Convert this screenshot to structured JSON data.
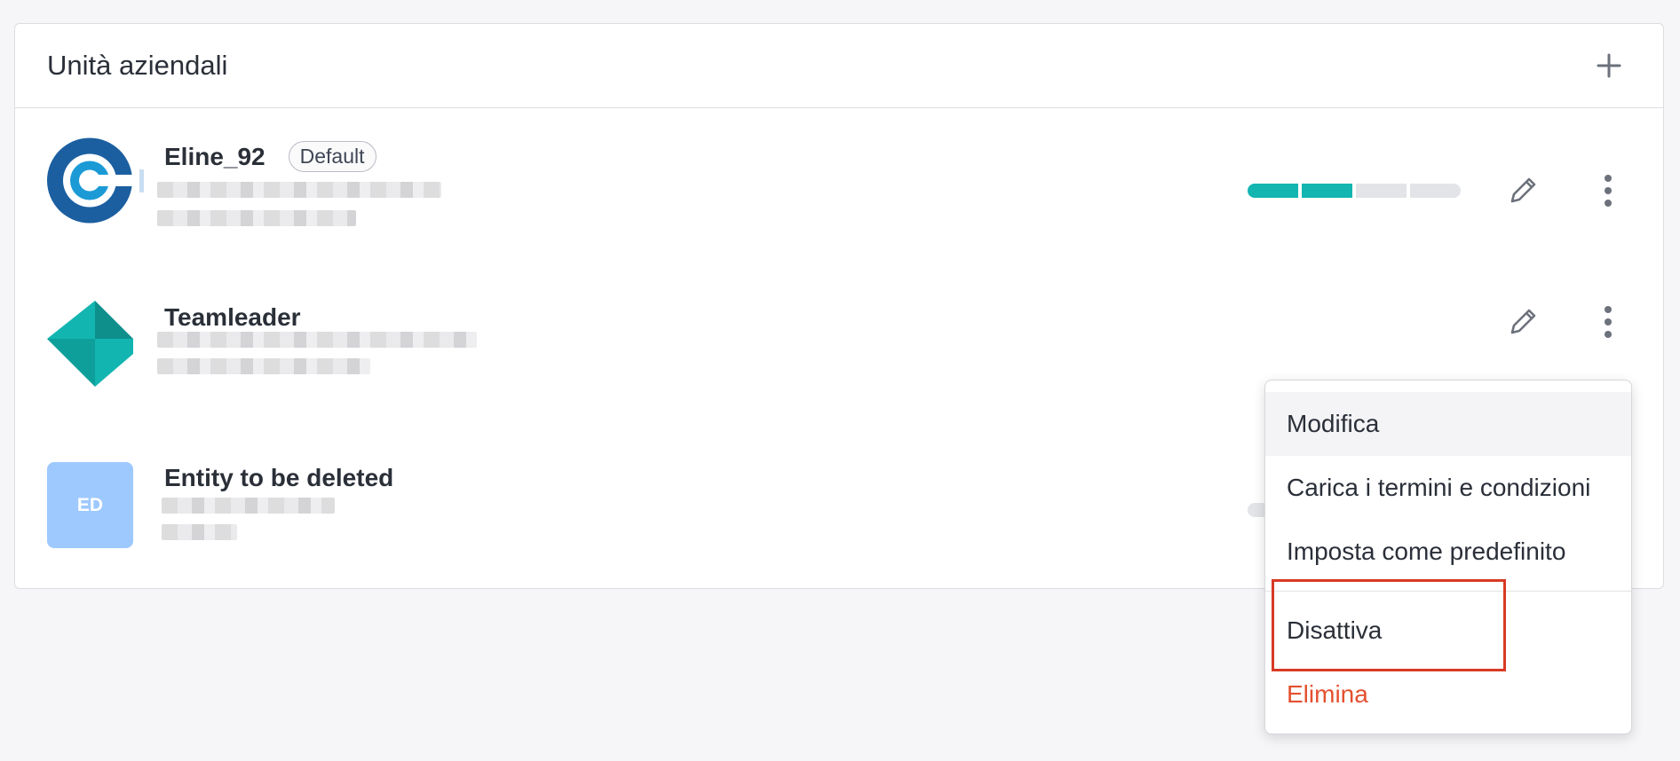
{
  "panel": {
    "title": "Unità aziendali",
    "add_icon": "plus-icon"
  },
  "entities": [
    {
      "name": "Eline_92",
      "badge": "Default",
      "logo_icon": "eline-logo",
      "progress": {
        "segments": 4,
        "filled": 2
      }
    },
    {
      "name": "Teamleader",
      "logo_icon": "teamleader-logo"
    },
    {
      "name": "Entity to be deleted",
      "initials": "ED"
    }
  ],
  "row_actions": {
    "edit_icon": "pencil-icon",
    "more_icon": "more-vertical-icon"
  },
  "context_menu": {
    "items": [
      "Modifica",
      "Carica i termini e condizioni",
      "Imposta come predefinito",
      "Disattiva",
      "Elimina"
    ]
  },
  "colors": {
    "accent": "#13b5b1",
    "danger": "#e4502f",
    "highlight": "#d83a24",
    "eline_blue": "#1b5fa0",
    "initials_bg": "#9ec9ff"
  }
}
